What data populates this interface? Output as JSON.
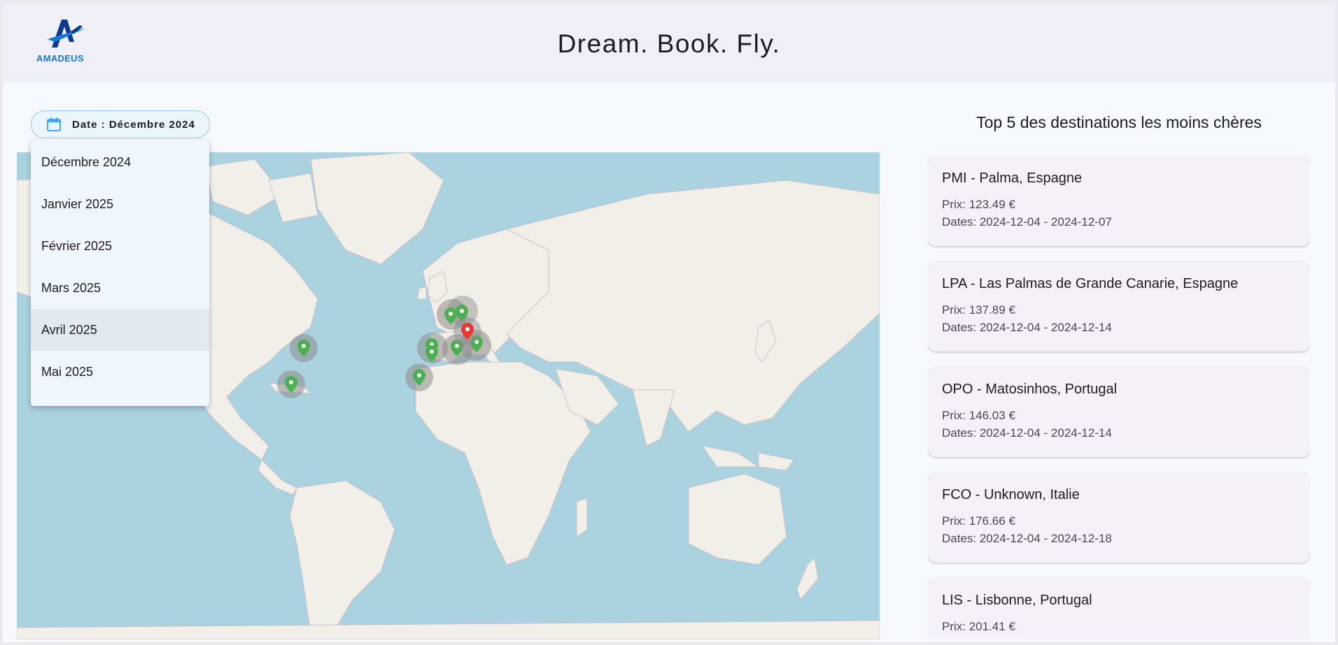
{
  "header": {
    "logo_text": "AMADEUS",
    "title": "Dream. Book. Fly."
  },
  "date_filter": {
    "label": "Date : Décembre 2024",
    "icon": "calendar-icon",
    "options": [
      "Décembre 2024",
      "Janvier 2025",
      "Février 2025",
      "Mars 2025",
      "Avril 2025",
      "Mai 2025"
    ],
    "hovered": "Avril 2025"
  },
  "top_destinations": {
    "title": "Top 5 des destinations les moins chères",
    "items": [
      {
        "name": "PMI - Palma, Espagne",
        "price": "Prix: 123.49 €",
        "dates": "Dates: 2024-12-04 - 2024-12-07"
      },
      {
        "name": "LPA - Las Palmas de Grande Canarie, Espagne",
        "price": "Prix: 137.89 €",
        "dates": "Dates: 2024-12-04 - 2024-12-14"
      },
      {
        "name": "OPO - Matosinhos, Portugal",
        "price": "Prix: 146.03 €",
        "dates": "Dates: 2024-12-04 - 2024-12-14"
      },
      {
        "name": "FCO - Unknown, Italie",
        "price": "Prix: 176.66 €",
        "dates": "Dates: 2024-12-04 - 2024-12-18"
      },
      {
        "name": "LIS - Lisbonne, Portugal",
        "price": "Prix: 201.41 €",
        "dates": ""
      }
    ]
  },
  "map": {
    "marker_icon": "map-pin-icon",
    "colors": {
      "destination": "#4caf50",
      "origin": "#e53935",
      "water": "#aad3df",
      "land": "#f2efe9"
    }
  }
}
